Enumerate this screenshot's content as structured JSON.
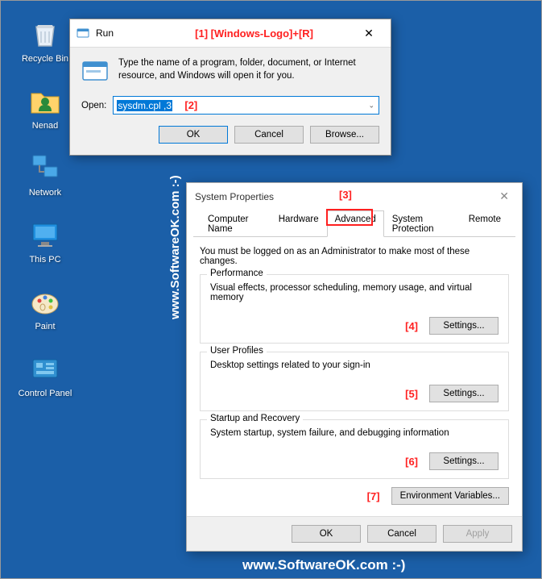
{
  "desktop": {
    "icons": [
      {
        "label": "Recycle Bin",
        "name": "recycle-bin-icon"
      },
      {
        "label": "Nenad",
        "name": "user-folder-icon"
      },
      {
        "label": "Network",
        "name": "network-icon"
      },
      {
        "label": "This PC",
        "name": "this-pc-icon"
      },
      {
        "label": "Paint",
        "name": "paint-icon"
      },
      {
        "label": "Control Panel",
        "name": "control-panel-icon"
      }
    ]
  },
  "run": {
    "title": "Run",
    "description": "Type the name of a program, folder, document, or Internet resource, and Windows will open it for you.",
    "open_label": "Open:",
    "input_value": "sysdm.cpl ,3",
    "ok": "OK",
    "cancel": "Cancel",
    "browse": "Browse..."
  },
  "annotations": {
    "a1": "[1]  [Windows-Logo]+[R]",
    "a2": "[2]",
    "a3": "[3]",
    "a4": "[4]",
    "a5": "[5]",
    "a6": "[6]",
    "a7": "[7]"
  },
  "sysprop": {
    "title": "System Properties",
    "tabs": [
      "Computer Name",
      "Hardware",
      "Advanced",
      "System Protection",
      "Remote"
    ],
    "intro": "You must be logged on as an Administrator to make most of these changes.",
    "performance": {
      "legend": "Performance",
      "desc": "Visual effects, processor scheduling, memory usage, and virtual memory",
      "btn": "Settings..."
    },
    "userprofiles": {
      "legend": "User Profiles",
      "desc": "Desktop settings related to your sign-in",
      "btn": "Settings..."
    },
    "startup": {
      "legend": "Startup and Recovery",
      "desc": "System startup, system failure, and debugging information",
      "btn": "Settings..."
    },
    "env_btn": "Environment Variables...",
    "ok": "OK",
    "cancel": "Cancel",
    "apply": "Apply"
  },
  "watermark": "www.SoftwareOK.com :-)"
}
